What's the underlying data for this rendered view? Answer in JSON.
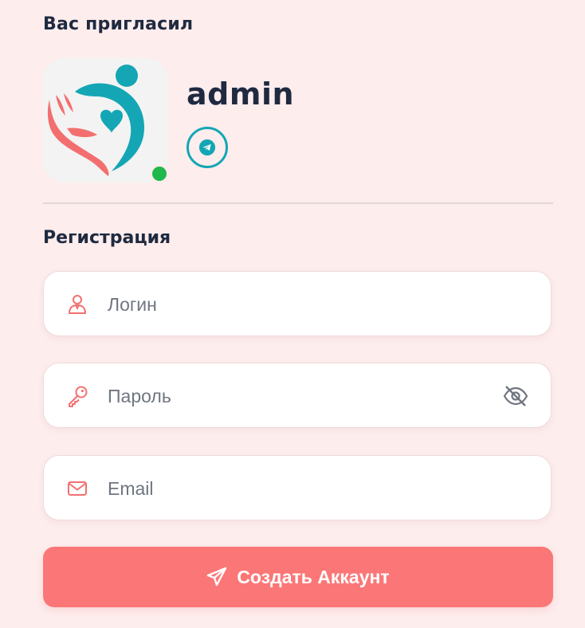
{
  "inviter": {
    "heading": "Вас пригласил",
    "username": "admin",
    "status": "online",
    "social_icon": "telegram-icon"
  },
  "registration": {
    "heading": "Регистрация",
    "fields": {
      "login": {
        "value": "",
        "placeholder": "Логин",
        "icon": "user-icon"
      },
      "password": {
        "value": "",
        "placeholder": "Пароль",
        "icon": "key-icon",
        "toggle_icon": "eye-slash-icon"
      },
      "email": {
        "value": "",
        "placeholder": "Email",
        "icon": "envelope-icon"
      }
    },
    "submit": {
      "label": "Создать Аккаунт",
      "icon": "paper-plane-icon"
    }
  },
  "colors": {
    "background": "#fdeded",
    "accent": "#fb7777",
    "brand_teal": "#14a6b4",
    "icon_coral": "#f36f6f",
    "online": "#1fb84c",
    "heading_text": "#1f2a40"
  }
}
